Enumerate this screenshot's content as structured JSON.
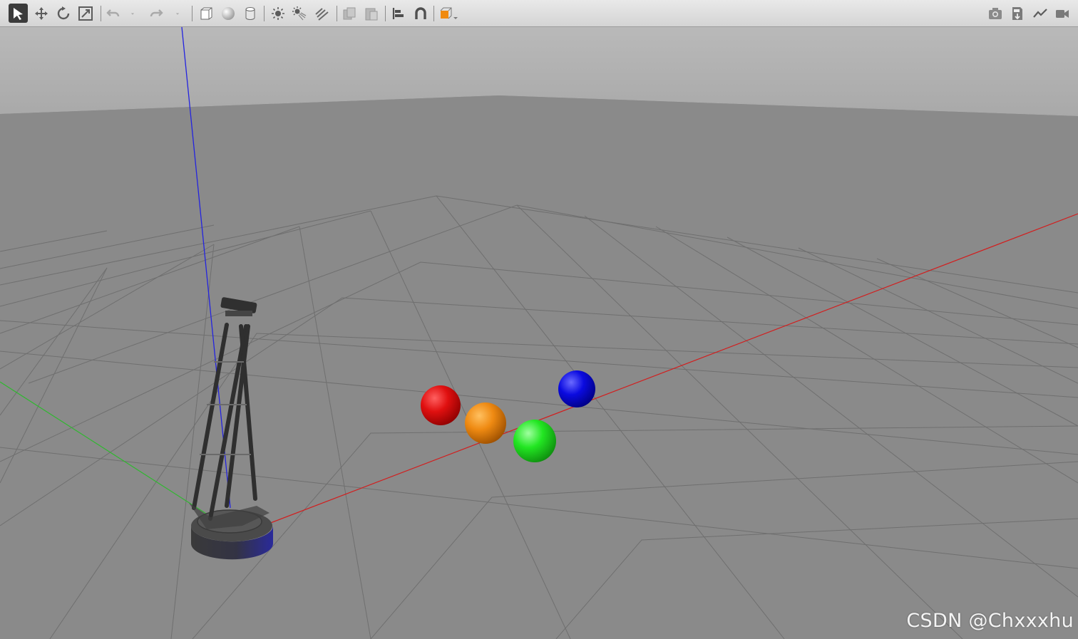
{
  "toolbar": {
    "left_tools": [
      {
        "name": "select-mode-icon",
        "tool": "select",
        "active": true
      },
      {
        "name": "translate-mode-icon",
        "tool": "translate"
      },
      {
        "name": "rotate-mode-icon",
        "tool": "rotate"
      },
      {
        "name": "scale-mode-icon",
        "tool": "scale"
      },
      {
        "name": "undo-icon",
        "tool": "undo",
        "disabled": true
      },
      {
        "name": "undo-history-icon",
        "tool": "undo-history",
        "disabled": true
      },
      {
        "name": "redo-icon",
        "tool": "redo",
        "disabled": true
      },
      {
        "name": "redo-history-icon",
        "tool": "redo-history",
        "disabled": true
      },
      {
        "name": "box-shape-icon",
        "tool": "box"
      },
      {
        "name": "sphere-shape-icon",
        "tool": "sphere"
      },
      {
        "name": "cylinder-shape-icon",
        "tool": "cylinder"
      },
      {
        "name": "point-light-icon",
        "tool": "point-light"
      },
      {
        "name": "spot-light-icon",
        "tool": "spot-light"
      },
      {
        "name": "directional-light-icon",
        "tool": "directional-light"
      },
      {
        "name": "copy-icon",
        "tool": "copy",
        "disabled": true
      },
      {
        "name": "paste-icon",
        "tool": "paste",
        "disabled": true
      },
      {
        "name": "align-icon",
        "tool": "align"
      },
      {
        "name": "snap-icon",
        "tool": "snap"
      },
      {
        "name": "view-angle-icon",
        "tool": "view-angle"
      }
    ],
    "right_tools": [
      {
        "name": "screenshot-icon",
        "tool": "screenshot"
      },
      {
        "name": "log-icon",
        "tool": "log"
      },
      {
        "name": "plot-icon",
        "tool": "plot"
      },
      {
        "name": "video-record-icon",
        "tool": "video"
      }
    ]
  },
  "scene": {
    "sky_color": "#b3b3b3",
    "ground_color": "#8a8a8a",
    "grid_line_color": "#6d6d6d",
    "axis_colors": {
      "x": "#d21e1e",
      "y": "#2fb82f",
      "z": "#2323e0"
    },
    "spheres": [
      {
        "name": "red",
        "color": "#e01010"
      },
      {
        "name": "orange",
        "color": "#f08a10"
      },
      {
        "name": "green",
        "color": "#22e622"
      },
      {
        "name": "blue",
        "color": "#0b0be0"
      }
    ],
    "robot_name": "turtlebot"
  },
  "watermark": "CSDN @Chxxxhu"
}
